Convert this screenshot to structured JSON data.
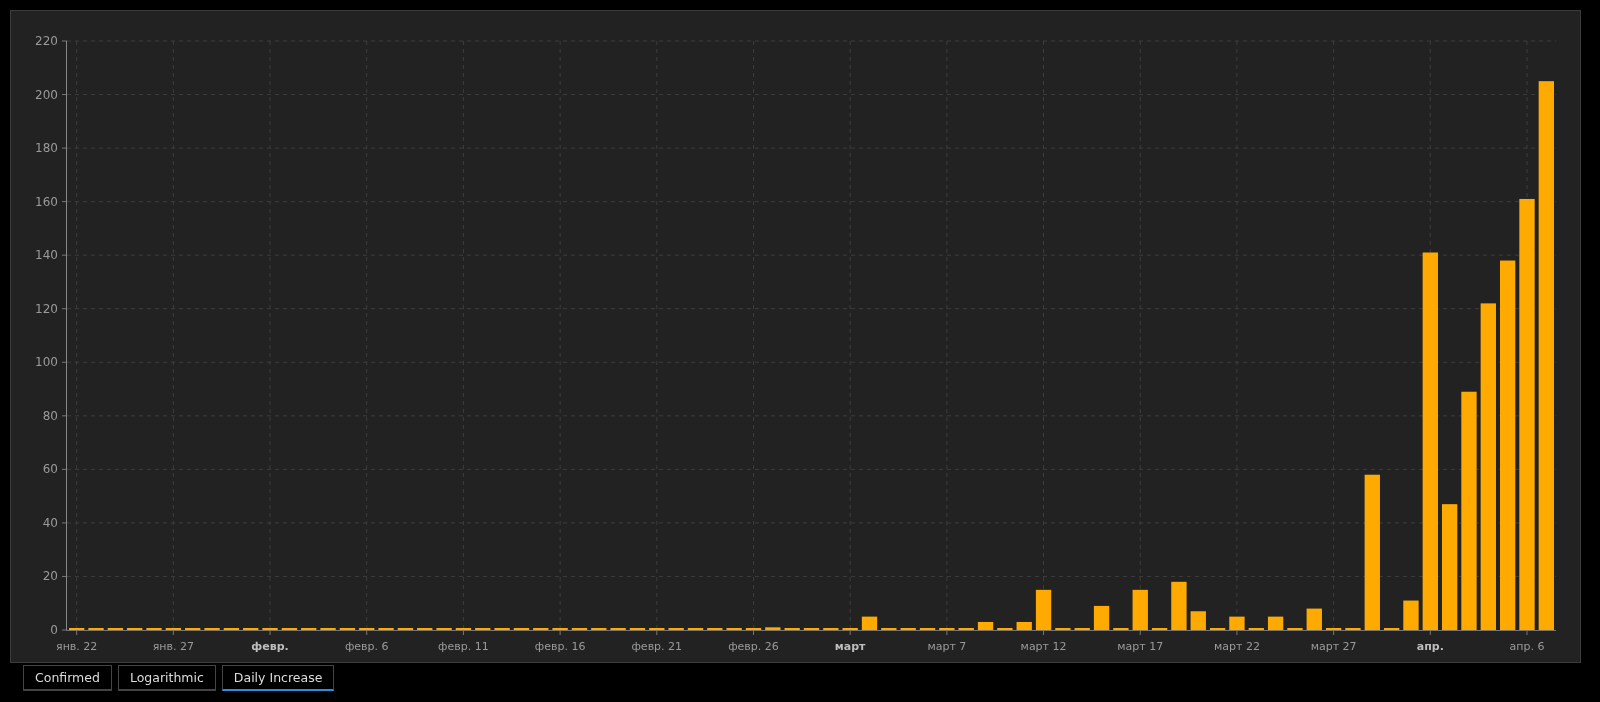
{
  "chart": {
    "chart_data": {
      "type": "bar",
      "color": "#ffaa00",
      "grid": true,
      "categories": [
        "янв. 22",
        null,
        null,
        null,
        null,
        "янв. 27",
        null,
        null,
        null,
        null,
        "**февр.**",
        null,
        null,
        null,
        null,
        "февр. 6",
        null,
        null,
        null,
        null,
        "февр. 11",
        null,
        null,
        null,
        null,
        "февр. 16",
        null,
        null,
        null,
        null,
        "февр. 21",
        null,
        null,
        null,
        null,
        "февр. 26",
        null,
        null,
        null,
        null,
        "**март**",
        null,
        null,
        null,
        null,
        "март 7",
        null,
        null,
        null,
        null,
        "март 12",
        null,
        null,
        null,
        null,
        "март 17",
        null,
        null,
        null,
        null,
        "март 22",
        null,
        null,
        null,
        null,
        "март 27",
        null,
        null,
        null,
        null,
        "**апр.**",
        null,
        null,
        null,
        null,
        "апр. 6",
        null
      ],
      "values": [
        0,
        0,
        0,
        0,
        0,
        0,
        0,
        0,
        0,
        0,
        0,
        0,
        0,
        0,
        0,
        0,
        0,
        0,
        0,
        0,
        0,
        0,
        0,
        0,
        0,
        0,
        0,
        0,
        0,
        0,
        0,
        0,
        0,
        0,
        0,
        0,
        1,
        0,
        0,
        0,
        0,
        5,
        0,
        0,
        0,
        0,
        0,
        3,
        0,
        3,
        15,
        0,
        0,
        9,
        0,
        15,
        0,
        18,
        7,
        0,
        5,
        0,
        5,
        0,
        8,
        0,
        0,
        58,
        0,
        11,
        141,
        47,
        89,
        122,
        138,
        161,
        205
      ],
      "ylim": [
        0,
        220
      ],
      "yticks": [
        0,
        20,
        40,
        60,
        80,
        100,
        120,
        140,
        160,
        180,
        200,
        220
      ]
    }
  },
  "tabs": [
    {
      "label": "Confirmed",
      "selected": false
    },
    {
      "label": "Logarithmic",
      "selected": false
    },
    {
      "label": "Daily Increase",
      "selected": true
    }
  ]
}
